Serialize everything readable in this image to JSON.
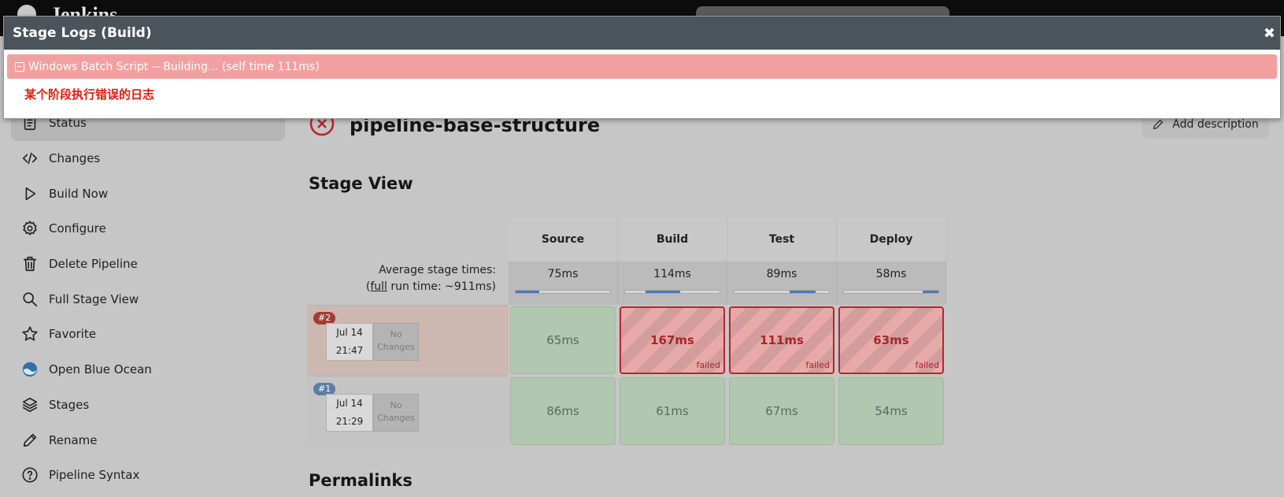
{
  "header": {
    "brand": "Jenkins"
  },
  "modal": {
    "title": "Stage Logs (Build)",
    "close_glyph": "✖",
    "log_step": "Windows Batch Script -- Building... (self time 111ms)",
    "log_output": "某个阶段执行错误的日志"
  },
  "sidebar": {
    "items": [
      {
        "label": "Status",
        "icon": "document-icon"
      },
      {
        "label": "Changes",
        "icon": "code-icon"
      },
      {
        "label": "Build Now",
        "icon": "play-icon"
      },
      {
        "label": "Configure",
        "icon": "gear-icon"
      },
      {
        "label": "Delete Pipeline",
        "icon": "trash-icon"
      },
      {
        "label": "Full Stage View",
        "icon": "search-icon"
      },
      {
        "label": "Favorite",
        "icon": "star-icon"
      },
      {
        "label": "Open Blue Ocean",
        "icon": "blue-ocean-icon"
      },
      {
        "label": "Stages",
        "icon": "layers-icon"
      },
      {
        "label": "Rename",
        "icon": "pencil-icon"
      },
      {
        "label": "Pipeline Syntax",
        "icon": "help-icon"
      }
    ]
  },
  "main": {
    "job_title": "pipeline-base-structure",
    "add_description": "Add description",
    "stage_view_heading": "Stage View",
    "permalinks_heading": "Permalinks"
  },
  "stage_view": {
    "avg_label_line1": "Average stage times:",
    "avg_label_pre": "(",
    "avg_label_link": "full",
    "avg_label_post": " run time: ~911ms)",
    "stages": [
      "Source",
      "Build",
      "Test",
      "Deploy"
    ],
    "avg_times": [
      "75ms",
      "114ms",
      "89ms",
      "58ms"
    ],
    "avg_bar_fill_fraction": [
      0.25,
      0.25,
      0.25,
      0.2
    ],
    "avg_bar_segment_index": [
      0,
      1,
      3,
      4
    ],
    "runs": [
      {
        "badge": "#2",
        "date": "Jul 14",
        "time": "21:47",
        "changes": "No Changes",
        "cells": [
          {
            "value": "65ms",
            "status": "ok"
          },
          {
            "value": "167ms",
            "status": "failed",
            "tag": "failed"
          },
          {
            "value": "111ms",
            "status": "failed",
            "tag": "failed"
          },
          {
            "value": "63ms",
            "status": "failed",
            "tag": "failed"
          }
        ]
      },
      {
        "badge": "#1",
        "date": "Jul 14",
        "time": "21:29",
        "changes": "No Changes",
        "cells": [
          {
            "value": "86ms",
            "status": "ok"
          },
          {
            "value": "61ms",
            "status": "ok"
          },
          {
            "value": "67ms",
            "status": "ok"
          },
          {
            "value": "54ms",
            "status": "ok"
          }
        ]
      }
    ]
  },
  "colors": {
    "failed_border": "#b8262b",
    "failed_text": "#a8262c",
    "log_bar": "#f2a09f",
    "log_error_text": "#e21a12",
    "modal_header": "#4b535b"
  }
}
